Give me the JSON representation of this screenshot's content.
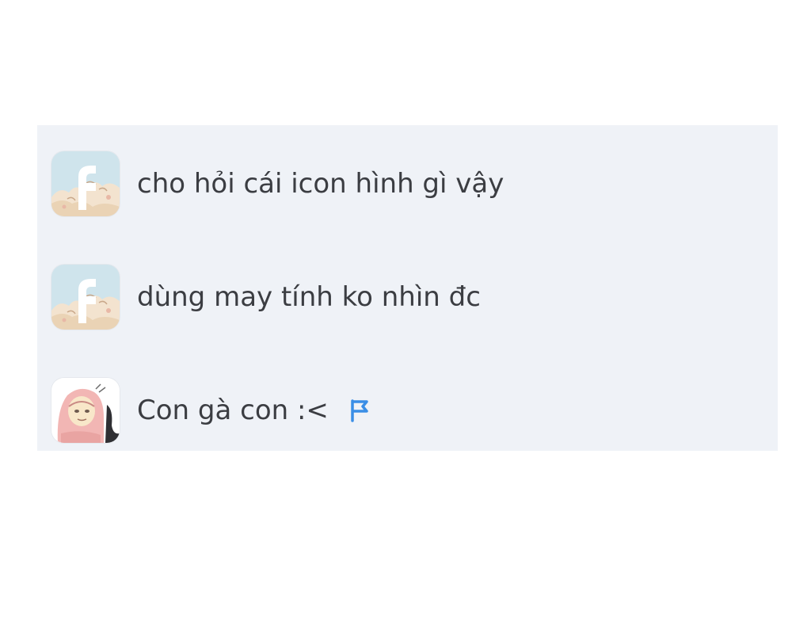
{
  "chat": {
    "messages": [
      {
        "avatar": "facebook-cartoon-avatar",
        "text": "cho hỏi cái icon hình gì vậy"
      },
      {
        "avatar": "facebook-cartoon-avatar",
        "text": "dùng may tính ko nhìn đc"
      },
      {
        "avatar": "pink-hood-character-avatar",
        "text": "Con gà con :<",
        "flag_icon": "flag-icon"
      }
    ]
  },
  "colors": {
    "panel_background": "#eff2f7",
    "text": "#3b3d42",
    "flag": "#3a8ee6"
  }
}
